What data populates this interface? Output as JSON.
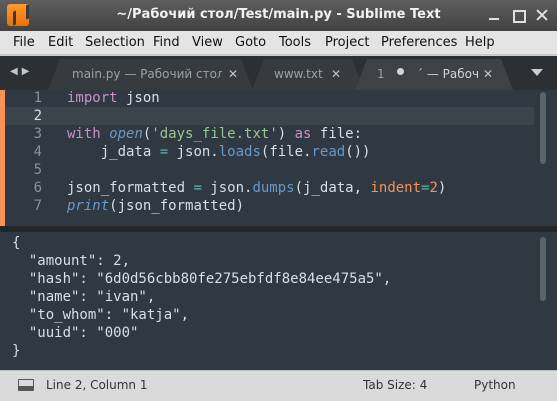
{
  "window": {
    "title": "~/Рабочий стол/Test/main.py - Sublime Text"
  },
  "menu": [
    "File",
    "Edit",
    "Selection",
    "Find",
    "View",
    "Goto",
    "Tools",
    "Project",
    "Preferences",
    "Help"
  ],
  "tabs": [
    {
      "label": "main.py — Рабочий стол",
      "close": "✕"
    },
    {
      "label": "www.txt",
      "close": "✕"
    },
    {
      "label": "1",
      "active_label": "´ — Рабоч",
      "close": "✕",
      "modified": true
    }
  ],
  "editor": {
    "lines": [
      "1",
      "2",
      "3",
      "4",
      "5",
      "6",
      "7"
    ],
    "current_line": 2
  },
  "code": {
    "l1_kw": "import",
    "l1_rest": " json",
    "l3_kw": "with",
    "l3_fn": "open",
    "l3_str": "'days_file.txt'",
    "l3_as": "as",
    "l3_rest": " file:",
    "l4_a": "    j_data ",
    "l4_eq": "=",
    "l4_b": " json.",
    "l4_fn": "loads",
    "l4_c": "(file.",
    "l4_fn2": "read",
    "l4_d": "())",
    "l6_a": "json_formatted ",
    "l6_eq": "=",
    "l6_b": " json.",
    "l6_fn": "dumps",
    "l6_c": "(j_data, ",
    "l6_param": "indent",
    "l6_eq2": "=",
    "l6_num": "2",
    "l6_d": ")",
    "l7_fn": "print",
    "l7_rest": "(json_formatted)"
  },
  "console": {
    "lines": [
      "{",
      "  \"amount\": 2,",
      "  \"hash\": \"6d0d56cbb80fe275ebfdf8e84ee475a5\",",
      "  \"name\": \"ivan\",",
      "  \"to_whom\": \"katja\",",
      "  \"uuid\": \"000\"",
      "}"
    ]
  },
  "status": {
    "position": "Line 2, Column 1",
    "tab_size": "Tab Size: 4",
    "syntax": "Python"
  },
  "colors": {
    "editor_bg": "#303841",
    "accent": "#f99157"
  }
}
